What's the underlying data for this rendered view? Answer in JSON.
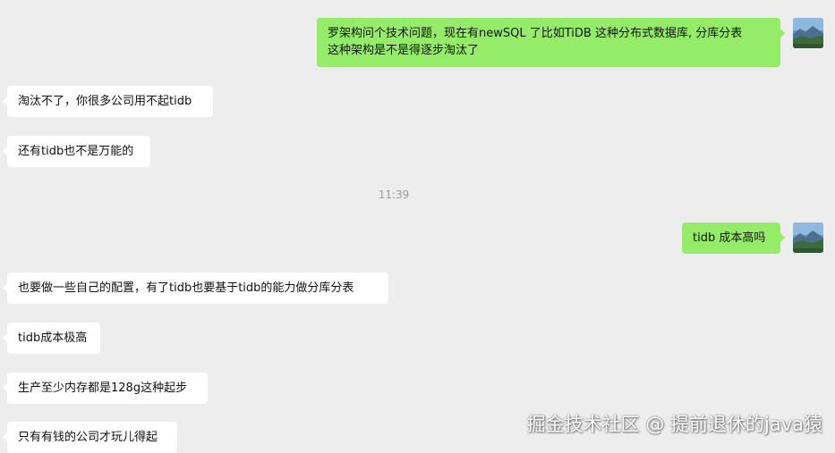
{
  "messages": [
    {
      "direction": "out",
      "lines": [
        "罗架构问个技术问题，现在有newSQL 了比如TiDB 这种分布式数据库, 分库分表",
        "这种架构是不是得逐步淘汰了"
      ]
    },
    {
      "direction": "in",
      "text": "淘汰不了，你很多公司用不起tidb"
    },
    {
      "direction": "in",
      "text": "还有tidb也不是万能的"
    },
    {
      "direction": "out",
      "text": "tidb 成本高吗"
    },
    {
      "direction": "in",
      "text": "也要做一些自己的配置，有了tidb也要基于tidb的能力做分库分表"
    },
    {
      "direction": "in",
      "text": "tidb成本极高"
    },
    {
      "direction": "in",
      "text": "生产至少内存都是128g这种起步"
    },
    {
      "direction": "in",
      "text": "只有有钱的公司才玩儿得起"
    }
  ],
  "timestamp": "11:39",
  "watermark": "掘金技术社区 @ 提前退休的java猿",
  "colors": {
    "background": "#ededed",
    "incoming_bubble": "#ffffff",
    "outgoing_bubble": "#95ec69",
    "timestamp_text": "#9a9a9a"
  },
  "icons": {
    "self_avatar": "landscape-avatar-icon"
  }
}
